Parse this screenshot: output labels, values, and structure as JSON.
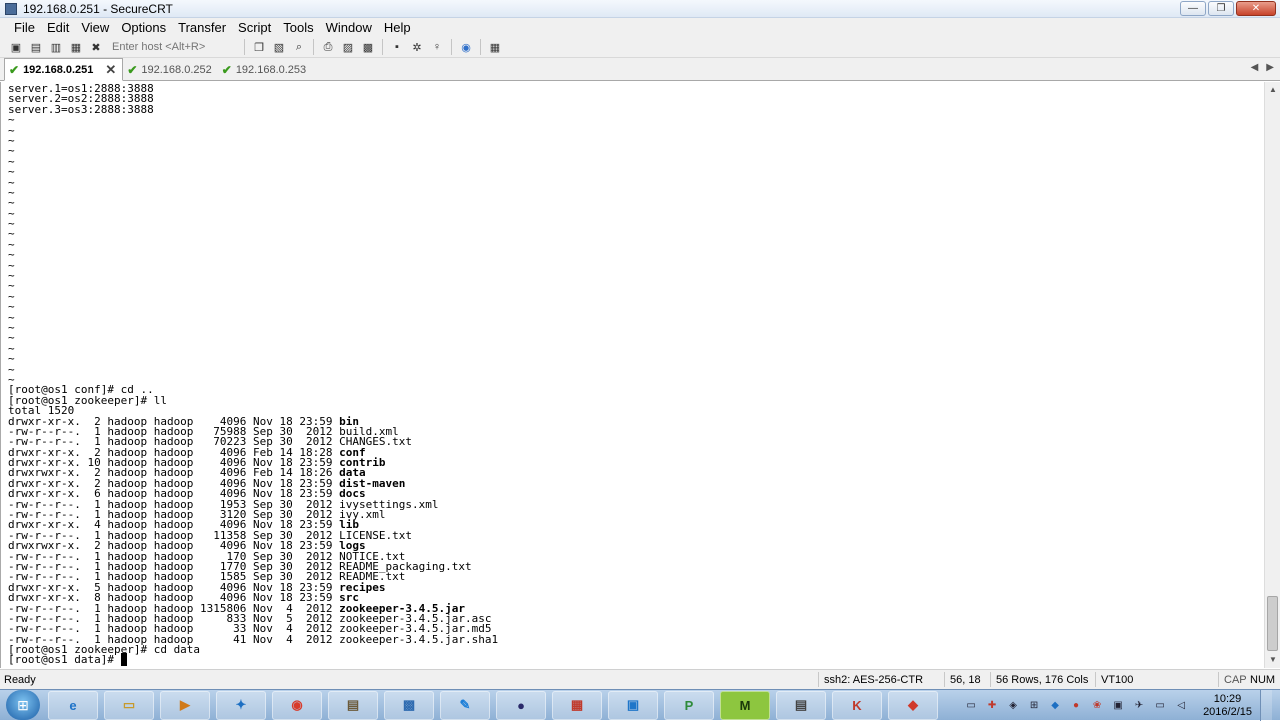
{
  "window": {
    "title": "192.168.0.251 - SecureCRT",
    "minimize": "—",
    "maximize": "❐",
    "close": "✕"
  },
  "menu": [
    "File",
    "Edit",
    "View",
    "Options",
    "Transfer",
    "Script",
    "Tools",
    "Window",
    "Help"
  ],
  "toolbar": {
    "host_placeholder": "Enter host <Alt+R>"
  },
  "tabs": [
    {
      "label": "192.168.0.251",
      "active": true,
      "icon": "check-icon",
      "close": "✕"
    },
    {
      "label": "192.168.0.252",
      "active": false,
      "icon": "check-icon"
    },
    {
      "label": "192.168.0.253",
      "active": false,
      "icon": "check-icon"
    }
  ],
  "terminal": {
    "top_lines": [
      "server.1=os1:2888:3888",
      "server.2=os2:2888:3888",
      "server.3=os3:2888:3888"
    ],
    "tilde": "~",
    "tilde_count": 26,
    "cmd1": "[root@os1 conf]# cd ..",
    "cmd2": "[root@os1 zookeeper]# ll",
    "total": "total 1520",
    "listing": [
      {
        "meta": "drwxr-xr-x.  2 hadoop hadoop    4096 Nov 18 23:59 ",
        "name": "bin",
        "dir": true
      },
      {
        "meta": "-rw-r--r--.  1 hadoop hadoop   75988 Sep 30  2012 ",
        "name": "build.xml",
        "dir": false
      },
      {
        "meta": "-rw-r--r--.  1 hadoop hadoop   70223 Sep 30  2012 ",
        "name": "CHANGES.txt",
        "dir": false
      },
      {
        "meta": "drwxr-xr-x.  2 hadoop hadoop    4096 Feb 14 18:28 ",
        "name": "conf",
        "dir": true
      },
      {
        "meta": "drwxr-xr-x. 10 hadoop hadoop    4096 Nov 18 23:59 ",
        "name": "contrib",
        "dir": true
      },
      {
        "meta": "drwxrwxr-x.  2 hadoop hadoop    4096 Feb 14 18:26 ",
        "name": "data",
        "dir": true
      },
      {
        "meta": "drwxr-xr-x.  2 hadoop hadoop    4096 Nov 18 23:59 ",
        "name": "dist-maven",
        "dir": true
      },
      {
        "meta": "drwxr-xr-x.  6 hadoop hadoop    4096 Nov 18 23:59 ",
        "name": "docs",
        "dir": true
      },
      {
        "meta": "-rw-r--r--.  1 hadoop hadoop    1953 Sep 30  2012 ",
        "name": "ivysettings.xml",
        "dir": false
      },
      {
        "meta": "-rw-r--r--.  1 hadoop hadoop    3120 Sep 30  2012 ",
        "name": "ivy.xml",
        "dir": false
      },
      {
        "meta": "drwxr-xr-x.  4 hadoop hadoop    4096 Nov 18 23:59 ",
        "name": "lib",
        "dir": true
      },
      {
        "meta": "-rw-r--r--.  1 hadoop hadoop   11358 Sep 30  2012 ",
        "name": "LICENSE.txt",
        "dir": false
      },
      {
        "meta": "drwxrwxr-x.  2 hadoop hadoop    4096 Nov 18 23:59 ",
        "name": "logs",
        "dir": true
      },
      {
        "meta": "-rw-r--r--.  1 hadoop hadoop     170 Sep 30  2012 ",
        "name": "NOTICE.txt",
        "dir": false
      },
      {
        "meta": "-rw-r--r--.  1 hadoop hadoop    1770 Sep 30  2012 ",
        "name": "README_packaging.txt",
        "dir": false
      },
      {
        "meta": "-rw-r--r--.  1 hadoop hadoop    1585 Sep 30  2012 ",
        "name": "README.txt",
        "dir": false
      },
      {
        "meta": "drwxr-xr-x.  5 hadoop hadoop    4096 Nov 18 23:59 ",
        "name": "recipes",
        "dir": true
      },
      {
        "meta": "drwxr-xr-x.  8 hadoop hadoop    4096 Nov 18 23:59 ",
        "name": "src",
        "dir": true
      },
      {
        "meta": "-rw-r--r--.  1 hadoop hadoop 1315806 Nov  4  2012 ",
        "name": "zookeeper-3.4.5.jar",
        "dir": true
      },
      {
        "meta": "-rw-r--r--.  1 hadoop hadoop     833 Nov  5  2012 ",
        "name": "zookeeper-3.4.5.jar.asc",
        "dir": false
      },
      {
        "meta": "-rw-r--r--.  1 hadoop hadoop      33 Nov  4  2012 ",
        "name": "zookeeper-3.4.5.jar.md5",
        "dir": false
      },
      {
        "meta": "-rw-r--r--.  1 hadoop hadoop      41 Nov  4  2012 ",
        "name": "zookeeper-3.4.5.jar.sha1",
        "dir": false
      }
    ],
    "cmd3": "[root@os1 zookeeper]# cd data",
    "prompt": "[root@os1 data]# "
  },
  "status": {
    "ready": "Ready",
    "cipher": "ssh2: AES-256-CTR",
    "cursor": "56,  18",
    "size": "56 Rows, 176 Cols",
    "emulation": "VT100",
    "cap": "CAP",
    "num": "NUM"
  },
  "taskbar": {
    "apps": [
      "ie-icon",
      "explorer-icon",
      "media-player-icon",
      "network-icon",
      "chrome-icon",
      "tool-icon",
      "secure-icon",
      "pen-icon",
      "eclipse-icon",
      "archive-icon",
      "vm-icon",
      "p-icon",
      "m-icon",
      "securecrt-icon",
      "k-icon",
      "red-icon"
    ],
    "time": "10:29",
    "date": "2016/2/15"
  }
}
